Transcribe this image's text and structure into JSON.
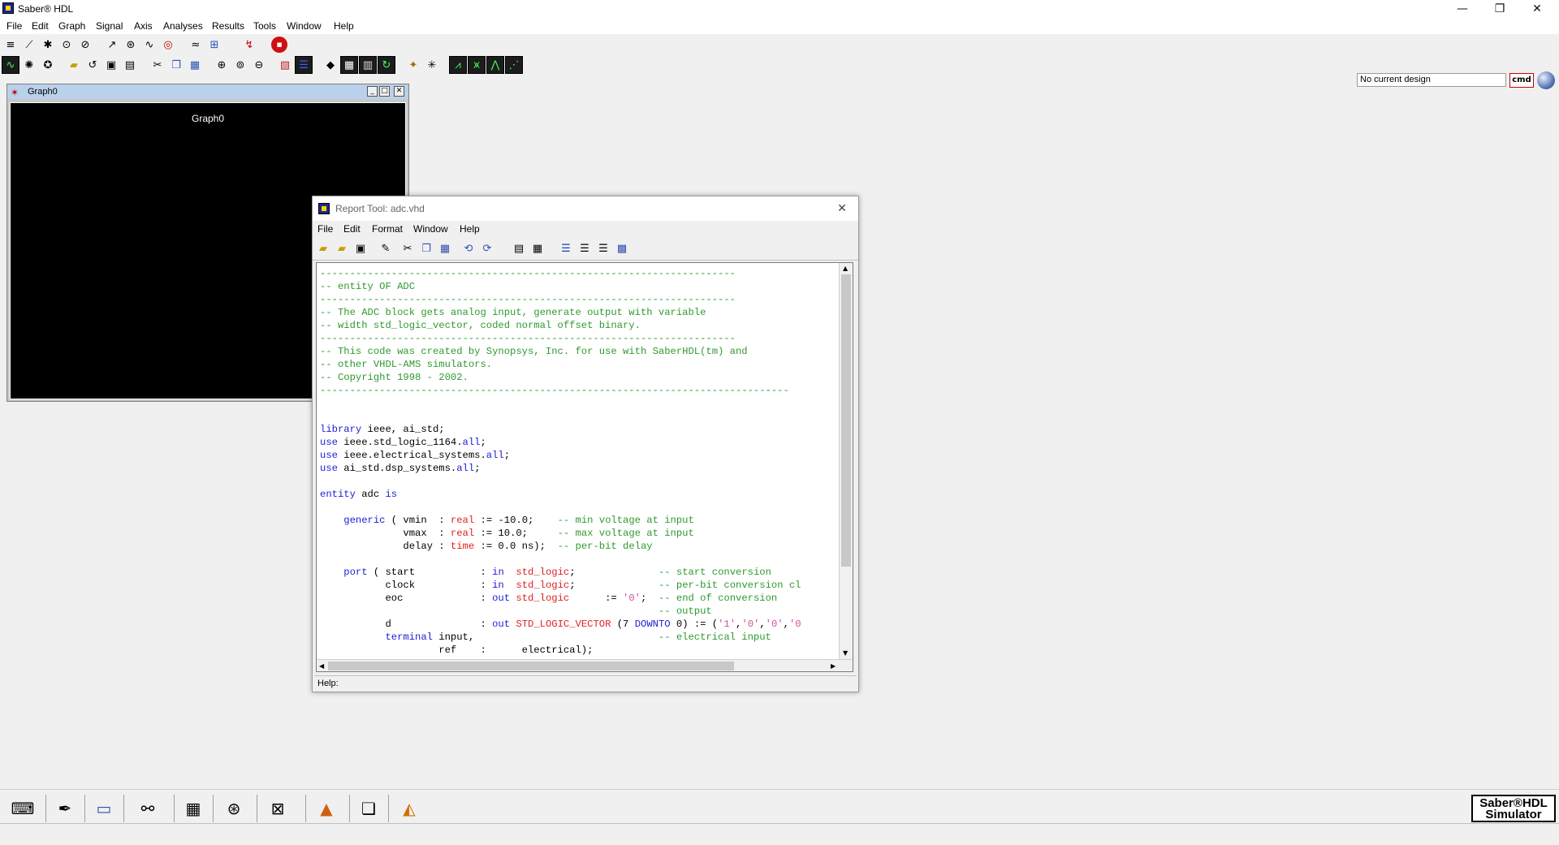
{
  "window": {
    "title": "Saber® HDL",
    "minimize": "—",
    "restore": "❐",
    "close": "✕"
  },
  "menubar": [
    "File",
    "Edit",
    "Graph",
    "Signal",
    "Axis",
    "Analyses",
    "Results",
    "Tools",
    "Window",
    "Help"
  ],
  "toolbar": {
    "design_field": "No current design",
    "cmd_button": "cmd",
    "icons_row1": [
      "sim-icon",
      "graph-icon",
      "probe-icon",
      "dc-icon",
      "tr-icon",
      "plot-icon",
      "sweep-icon",
      "pz-icon",
      "target-icon",
      "wave-icon",
      "net-icon",
      "measure-icon",
      "stop-icon"
    ],
    "icons_row2": [
      "osc-icon",
      "fan-icon",
      "compass-icon",
      "open-icon",
      "undo-icon",
      "save-icon",
      "print-icon",
      "cut-icon",
      "copy-icon",
      "paste-icon",
      "zoom-in-icon",
      "zoom-fit-icon",
      "zoom-out-icon",
      "color-icon",
      "stack-icon",
      "pencil-icon",
      "grid-icon",
      "table-icon",
      "reload-icon",
      "marker-icon",
      "bug-icon",
      "eye-signal-icon",
      "sig-a-icon",
      "sig-b-icon",
      "sig-c-icon"
    ]
  },
  "graph_window": {
    "title": "Graph0",
    "canvas_label": "Graph0"
  },
  "report_tool": {
    "title": "Report Tool: adc.vhd",
    "menu": [
      "File",
      "Edit",
      "Format",
      "Window",
      "Help"
    ],
    "status": "Help:",
    "lines": [
      [
        [
          "cm",
          "----------------------------------------------------------------------"
        ]
      ],
      [
        [
          "cm",
          "-- entity OF ADC"
        ]
      ],
      [
        [
          "cm",
          "----------------------------------------------------------------------"
        ]
      ],
      [
        [
          "cm",
          "-- The ADC block gets analog input, generate output with variable"
        ]
      ],
      [
        [
          "cm",
          "-- width std_logic_vector, coded normal offset binary."
        ]
      ],
      [
        [
          "cm",
          "----------------------------------------------------------------------"
        ]
      ],
      [
        [
          "cm",
          "-- This code was created by Synopsys, Inc. for use with SaberHDL(tm) and"
        ]
      ],
      [
        [
          "cm",
          "-- other VHDL-AMS simulators."
        ]
      ],
      [
        [
          "cm",
          "-- Copyright 1998 - 2002."
        ]
      ],
      [
        [
          "cm",
          "-------------------------------------------------------------------------------"
        ]
      ],
      [
        [
          "tx",
          ""
        ]
      ],
      [
        [
          "tx",
          ""
        ]
      ],
      [
        [
          "kw",
          "library"
        ],
        [
          "tx",
          " ieee, ai_std;"
        ]
      ],
      [
        [
          "kw",
          "use"
        ],
        [
          "tx",
          " ieee.std_logic_1164."
        ],
        [
          "kw",
          "all"
        ],
        [
          "tx",
          ";"
        ]
      ],
      [
        [
          "kw",
          "use"
        ],
        [
          "tx",
          " ieee.electrical_systems."
        ],
        [
          "kw",
          "all"
        ],
        [
          "tx",
          ";"
        ]
      ],
      [
        [
          "kw",
          "use"
        ],
        [
          "tx",
          " ai_std.dsp_systems."
        ],
        [
          "kw",
          "all"
        ],
        [
          "tx",
          ";"
        ]
      ],
      [
        [
          "tx",
          ""
        ]
      ],
      [
        [
          "kw",
          "entity"
        ],
        [
          "tx",
          " adc "
        ],
        [
          "kw",
          "is"
        ]
      ],
      [
        [
          "tx",
          ""
        ]
      ],
      [
        [
          "tx",
          "    "
        ],
        [
          "kw",
          "generic"
        ],
        [
          "tx",
          " ( vmin  : "
        ],
        [
          "ty",
          "real"
        ],
        [
          "tx",
          " := -10.0;    "
        ],
        [
          "cm",
          "-- min voltage at input"
        ]
      ],
      [
        [
          "tx",
          "              vmax  : "
        ],
        [
          "ty",
          "real"
        ],
        [
          "tx",
          " := 10.0;     "
        ],
        [
          "cm",
          "-- max voltage at input"
        ]
      ],
      [
        [
          "tx",
          "              delay : "
        ],
        [
          "ty",
          "time"
        ],
        [
          "tx",
          " := 0.0 ns);  "
        ],
        [
          "cm",
          "-- per-bit delay"
        ]
      ],
      [
        [
          "tx",
          ""
        ]
      ],
      [
        [
          "tx",
          "    "
        ],
        [
          "kw",
          "port"
        ],
        [
          "tx",
          " ( start           : "
        ],
        [
          "kw",
          "in"
        ],
        [
          "tx",
          "  "
        ],
        [
          "ty",
          "std_logic"
        ],
        [
          "tx",
          ";              "
        ],
        [
          "cm",
          "-- start conversion"
        ]
      ],
      [
        [
          "tx",
          "           clock           : "
        ],
        [
          "kw",
          "in"
        ],
        [
          "tx",
          "  "
        ],
        [
          "ty",
          "std_logic"
        ],
        [
          "tx",
          ";              "
        ],
        [
          "cm",
          "-- per-bit conversion cl"
        ]
      ],
      [
        [
          "tx",
          "           eoc             : "
        ],
        [
          "kw",
          "out"
        ],
        [
          "tx",
          " "
        ],
        [
          "ty",
          "std_logic"
        ],
        [
          "tx",
          "      := "
        ],
        [
          "st",
          "'0'"
        ],
        [
          "tx",
          ";  "
        ],
        [
          "cm",
          "-- end of conversion"
        ]
      ],
      [
        [
          "tx",
          "                                                         "
        ],
        [
          "cm",
          "-- output"
        ]
      ],
      [
        [
          "tx",
          "           d               : "
        ],
        [
          "kw",
          "out"
        ],
        [
          "tx",
          " "
        ],
        [
          "ty",
          "STD_LOGIC_VECTOR"
        ],
        [
          "tx",
          " (7 "
        ],
        [
          "kw",
          "DOWNTO"
        ],
        [
          "tx",
          " 0) := ("
        ],
        [
          "st",
          "'1'"
        ],
        [
          "tx",
          ","
        ],
        [
          "st",
          "'0'"
        ],
        [
          "tx",
          ","
        ],
        [
          "st",
          "'0'"
        ],
        [
          "tx",
          ","
        ],
        [
          "st",
          "'0"
        ]
      ],
      [
        [
          "tx",
          "           "
        ],
        [
          "kw",
          "terminal"
        ],
        [
          "tx",
          " input,                               "
        ],
        [
          "cm",
          "-- electrical input"
        ]
      ],
      [
        [
          "tx",
          "                    ref    :      electrical);"
        ]
      ]
    ]
  },
  "bottom_toolbar": {
    "icons": [
      "keyboard-icon",
      "pen-icon",
      "scope-icon",
      "scissors-probe-icon",
      "calculator-icon",
      "meters-icon",
      "filter-icon",
      "matlab-icon",
      "docs-icon",
      "shapes-icon"
    ],
    "logo_line1": "Saber®HDL",
    "logo_line2": "Simulator"
  }
}
